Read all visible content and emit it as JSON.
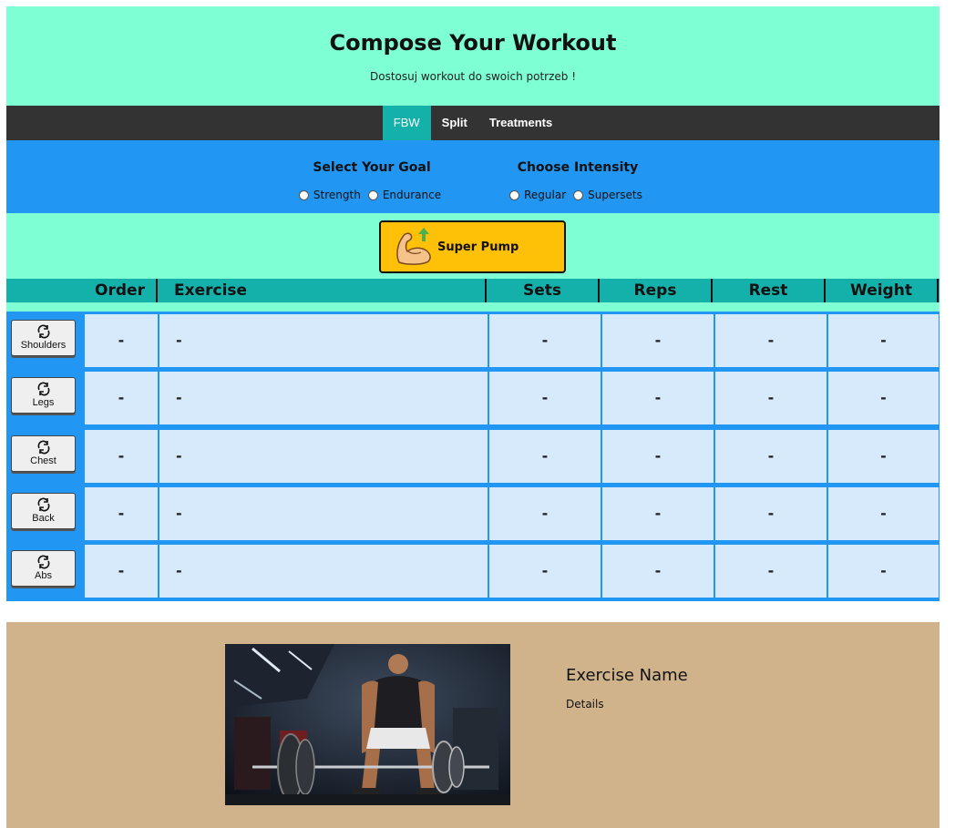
{
  "header": {
    "title": "Compose Your Workout",
    "subtitle": "Dostosuj workout do swoich potrzeb !"
  },
  "nav": {
    "tabs": [
      {
        "label": "FBW",
        "active": true
      },
      {
        "label": "Split",
        "active": false
      },
      {
        "label": "Treatments",
        "active": false
      }
    ]
  },
  "goal": {
    "title": "Select Your Goal",
    "options": [
      "Strength",
      "Endurance"
    ]
  },
  "intensity": {
    "title": "Choose Intensity",
    "options": [
      "Regular",
      "Supersets"
    ]
  },
  "pump_button": {
    "label": "Super Pump",
    "icon": "flexed-biceps-icon"
  },
  "table": {
    "headers": [
      "Order",
      "Exercise",
      "Sets",
      "Reps",
      "Rest",
      "Weight"
    ],
    "rows": [
      {
        "muscle": "Shoulders",
        "order": "-",
        "exercise": "-",
        "sets": "-",
        "reps": "-",
        "rest": "-",
        "weight": "-"
      },
      {
        "muscle": "Legs",
        "order": "-",
        "exercise": "-",
        "sets": "-",
        "reps": "-",
        "rest": "-",
        "weight": "-"
      },
      {
        "muscle": "Chest",
        "order": "-",
        "exercise": "-",
        "sets": "-",
        "reps": "-",
        "rest": "-",
        "weight": "-"
      },
      {
        "muscle": "Back",
        "order": "-",
        "exercise": "-",
        "sets": "-",
        "reps": "-",
        "rest": "-",
        "weight": "-"
      },
      {
        "muscle": "Abs",
        "order": "-",
        "exercise": "-",
        "sets": "-",
        "reps": "-",
        "rest": "-",
        "weight": "-"
      }
    ]
  },
  "detail": {
    "name": "Exercise Name",
    "details": "Details"
  },
  "colors": {
    "mint": "#7fffd4",
    "nav": "#333333",
    "teal": "#14b1ab",
    "blue": "#2196f3",
    "cell": "#d6eafb",
    "pump": "#ffc107",
    "tan": "#d1b38b"
  }
}
